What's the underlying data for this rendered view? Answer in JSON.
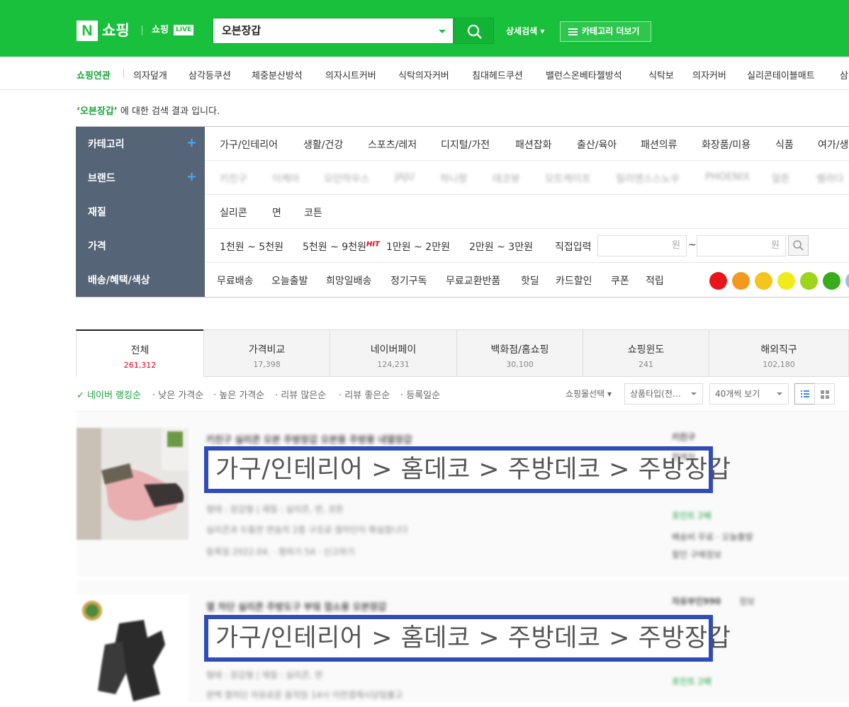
{
  "header": {
    "logo_n": "N",
    "logo_text": "쇼핑",
    "live_text": "쇼핑",
    "live_badge": "LIVE",
    "search_value": "오븐장갑",
    "detail_search": "상세검색 ▾",
    "category_more": "카테고리 더보기"
  },
  "related": {
    "label": "쇼핑연관",
    "items": [
      "의자덮개",
      "삼각등쿠션",
      "체중분산방석",
      "의자시트커버",
      "식탁의자커버",
      "침대헤드쿠션",
      "밸런스온베타젤방석",
      "식탁보",
      "의자커버",
      "실리콘테이블매트",
      "삼"
    ]
  },
  "result_message": {
    "keyword": "‘오븐장갑’",
    "suffix": " 에 대한 검색 결과 입니다."
  },
  "filters": {
    "category_label": "카테고리",
    "brand_label": "브랜드",
    "material_label": "재질",
    "price_label": "가격",
    "delivery_label": "배송/혜택/색상",
    "plus": "+",
    "categories": [
      "가구/인테리어",
      "생활/건강",
      "스포츠/레저",
      "디지털/가전",
      "패션잡화",
      "출산/육아",
      "패션의류",
      "화장품/미용",
      "식품",
      "여가/생"
    ],
    "brands": [
      "키친구",
      "이케아",
      "모던하우스",
      "JAJU",
      "하니팡",
      "데코뷰",
      "모트케이프",
      "릴리앤스스노우",
      "PHOENIX",
      "알튼",
      "벨라다"
    ],
    "materials": [
      "실리콘",
      "면",
      "코튼"
    ],
    "prices": [
      "1천원 ~ 5천원",
      "5천원 ~ 9천원",
      "1만원 ~ 2만원",
      "2만원 ~ 3만원"
    ],
    "hit": "HIT",
    "direct_input": "직접입력",
    "won": "원",
    "tilde": "~",
    "deliveries": [
      "무료배송",
      "오늘출발",
      "희망일배송",
      "정기구독",
      "무료교환반품",
      "핫딜",
      "카드할인",
      "쿠폰",
      "적립"
    ],
    "colors": [
      "#e8161b",
      "#f39a1e",
      "#f4c51f",
      "#f0ec1b",
      "#9cd51a",
      "#38ad1c",
      "#86c8ef"
    ]
  },
  "tabs": [
    {
      "label": "전체",
      "count": "261,312"
    },
    {
      "label": "가격비교",
      "count": "17,398"
    },
    {
      "label": "네이버페이",
      "count": "124,231"
    },
    {
      "label": "백화점/홈쇼핑",
      "count": "30,100"
    },
    {
      "label": "쇼핑윈도",
      "count": "241"
    },
    {
      "label": "해외직구",
      "count": "102,180"
    }
  ],
  "sort": {
    "items": [
      "네이버 랭킹순",
      "낮은 가격순",
      "높은 가격순",
      "리뷰 많은순",
      "리뷰 좋은순",
      "등록일순"
    ],
    "mall_select": "쇼핑몰선택",
    "product_type": "상품타입(전…",
    "per_page": "40개씩 보기"
  },
  "products": [
    {
      "title": "키친구 실리콘 오븐 주방장갑 오븐용 주방용 내열장갑",
      "category_path": "가구/인테리어 > 홈데코 > 주방데코 > 주방장갑",
      "spec": "형태 : 장갑형  |  재질 : 실리콘, 면, 코튼",
      "desc": "실리콘과 두툼한 면솜의 2중 구조로 열차단이 확실합니다",
      "meta": "등록일 2022.04.  ·  찜하기 54  ·  신고하기",
      "mall": "키친구",
      "mall_sub": "판매처",
      "delivery": "배송비 무료 · 오늘출발",
      "points": "포인트 2배",
      "discount": "할인 구매정보"
    },
    {
      "title": "열 차단 실리콘 주방도구 부엌 접소용 오븐장갑",
      "category_path": "가구/인테리어 > 홈데코 > 주방데코 > 주방장갑",
      "spec": "형태 : 장갑형  |  재질 : 실리콘, 면",
      "desc": "완벽 열차단 자유로운 움직임 14시 이전결제시당일출고",
      "mall": "자유부인990",
      "mall_sub": "정보",
      "points": "포인트 2배"
    }
  ]
}
